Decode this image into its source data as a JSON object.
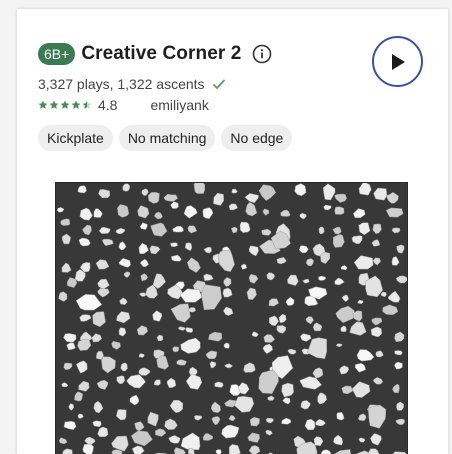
{
  "problem": {
    "grade": "6B+",
    "name": "Creative Corner 2",
    "stats": "3,327 plays, 1,322 ascents",
    "rating": "4.8",
    "stars": 4.5,
    "setter": "emiliyank",
    "tags": [
      "Kickplate",
      "No matching",
      "No edge"
    ]
  },
  "icons": {
    "info": "info-icon",
    "play": "play-icon",
    "check": "check-icon",
    "star": "star-icon"
  },
  "colors": {
    "grade_badge": "#3c7a51",
    "play_border": "#3b4fa0",
    "check": "#5a9a6a",
    "board": "#383838"
  }
}
